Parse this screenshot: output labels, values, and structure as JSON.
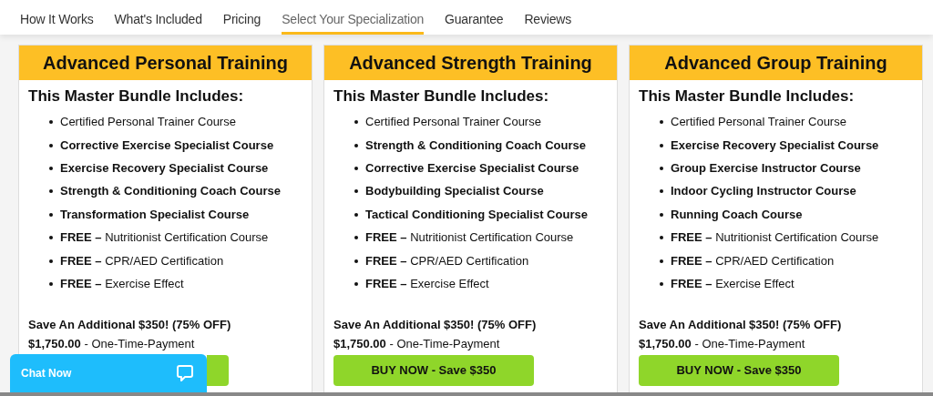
{
  "nav": [
    {
      "label": "How It Works",
      "selected": false
    },
    {
      "label": "What's Included",
      "selected": false
    },
    {
      "label": "Pricing",
      "selected": false
    },
    {
      "label": "Select Your Specialization",
      "selected": true
    },
    {
      "label": "Guarantee",
      "selected": false
    },
    {
      "label": "Reviews",
      "selected": false
    }
  ],
  "cards": [
    {
      "title": "Advanced Personal Training",
      "subtitle": "This Master Bundle Includes:",
      "items": [
        {
          "text": "Certified Personal Trainer Course"
        },
        {
          "text": "**Corrective Exercise Specialist Course**"
        },
        {
          "text": "**Exercise Recovery Specialist Course**"
        },
        {
          "text": "**Strength & Conditioning Coach Course**"
        },
        {
          "text": "**Transformation Specialist Course**"
        },
        {
          "text": "**FREE –** Nutritionist Certification Course"
        },
        {
          "text": "**FREE –** CPR/AED Certification"
        },
        {
          "text": "**FREE –** Exercise Effect"
        }
      ],
      "savings": "Save An Additional $350! (75% OFF)",
      "price": "**$1,750.00** - One-Time-Payment"
    },
    {
      "title": "Advanced Strength Training",
      "subtitle": "This Master Bundle Includes:",
      "items": [
        {
          "text": "Certified Personal Trainer Course"
        },
        {
          "text": "**Strength & Conditioning Coach Course**"
        },
        {
          "text": "**Corrective Exercise Specialist Course**"
        },
        {
          "text": "**Bodybuilding Specialist Course**"
        },
        {
          "text": "**Tactical Conditioning Specialist Course**"
        },
        {
          "text": "**FREE –** Nutritionist Certification Course"
        },
        {
          "text": "**FREE –** CPR/AED Certification"
        },
        {
          "text": "**FREE –** Exercise Effect"
        }
      ],
      "savings": "Save An Additional $350! (75% OFF)",
      "price": "**$1,750.00** - One-Time-Payment",
      "button": "BUY NOW - Save $350"
    },
    {
      "title": "Advanced Group Training",
      "subtitle": "This Master Bundle Includes:",
      "items": [
        {
          "text": "Certified Personal Trainer Course"
        },
        {
          "text": "**Exercise Recovery Specialist Course**"
        },
        {
          "text": "**Group Exercise Instructor Course**"
        },
        {
          "text": "**Indoor Cycling Instructor Course**"
        },
        {
          "text": "**Running Coach Course**"
        },
        {
          "text": "**FREE –** Nutritionist Certification Course"
        },
        {
          "text": "**FREE –** CPR/AED Certification"
        },
        {
          "text": "**FREE –** Exercise Effect"
        }
      ],
      "savings": "Save An Additional $350! (75% OFF)",
      "price": "**$1,750.00** - One-Time-Payment",
      "button": "BUY NOW - Save $350"
    }
  ],
  "chat": {
    "label": "Chat Now"
  }
}
